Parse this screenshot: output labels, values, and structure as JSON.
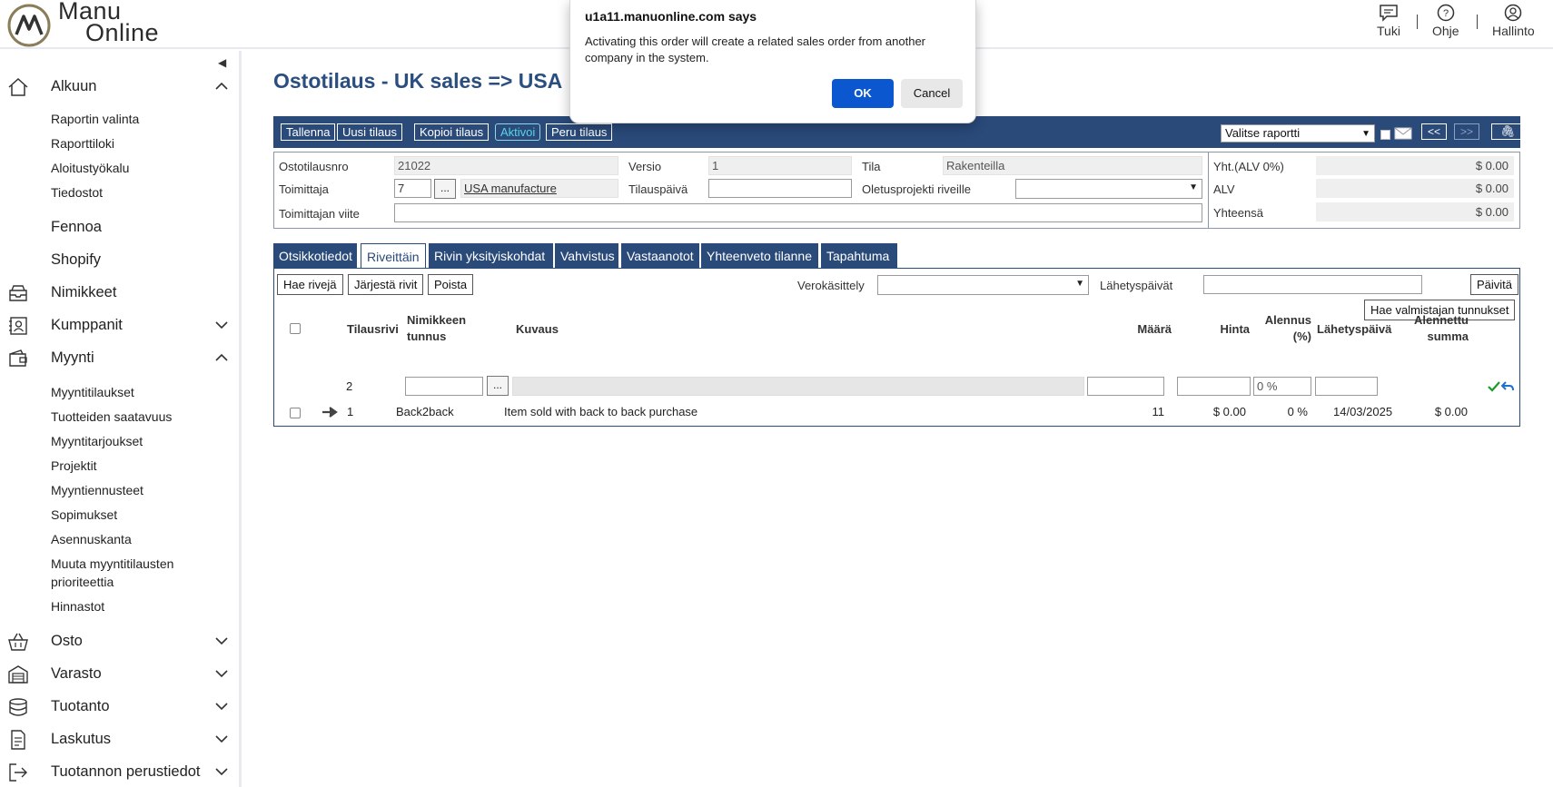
{
  "header": {
    "logo_line1": "Manu",
    "logo_line2": "Online",
    "links": [
      {
        "label": "Tuki",
        "icon": "chat-icon"
      },
      {
        "label": "Ohje",
        "icon": "help-circle-icon"
      },
      {
        "label": "Hallinto",
        "icon": "user-icon"
      }
    ],
    "separator": "|"
  },
  "sidebar": {
    "collapse_glyph": "◀",
    "sections": [
      {
        "label": "Alkuun",
        "icon": "home-icon",
        "expanded": true,
        "items": [
          "Raportin valinta",
          "Raporttiloki",
          "Aloitustyökalu",
          "Tiedostot"
        ]
      },
      {
        "label": "Fennoa"
      },
      {
        "label": "Shopify"
      },
      {
        "label": "Nimikkeet",
        "icon": "inbox-icon"
      },
      {
        "label": "Kumppanit",
        "icon": "contacts-icon",
        "expanded": false
      },
      {
        "label": "Myynti",
        "icon": "wallet-icon",
        "expanded": true,
        "items": [
          "Myyntitilaukset",
          "Tuotteiden saatavuus",
          "Myyntitarjoukset",
          "Projektit",
          "Myyntiennusteet",
          "Sopimukset",
          "Asennuskanta",
          "Muuta myyntitilausten prioriteettia",
          "Hinnastot"
        ]
      },
      {
        "label": "Osto",
        "icon": "basket-icon",
        "expanded": false
      },
      {
        "label": "Varasto",
        "icon": "warehouse-icon",
        "expanded": false
      },
      {
        "label": "Tuotanto",
        "icon": "database-icon",
        "expanded": false
      },
      {
        "label": "Laskutus",
        "icon": "invoice-icon",
        "expanded": false
      },
      {
        "label": "Tuotannon perustiedot",
        "icon": "logout-icon",
        "expanded": false
      }
    ]
  },
  "main": {
    "title": "Ostotilaus - UK sales => USA",
    "toolbar": {
      "buttons": [
        "Tallenna",
        "Uusi tilaus",
        "Kopioi tilaus",
        "Aktivoi",
        "Peru tilaus"
      ],
      "report_select": "Valitse raportti",
      "prev": "<<",
      "next": ">>",
      "attach_glyph": "🖇"
    },
    "form": {
      "order_no_label": "Ostotilausnro",
      "order_no": "21022",
      "version_label": "Versio",
      "version": "1",
      "status_label": "Tila",
      "status": "Rakenteilla",
      "supplier_label": "Toimittaja",
      "supplier_id": "7",
      "lookup_glyph": "...",
      "supplier_name": "USA manufacture",
      "order_date_label": "Tilauspäivä",
      "order_date": "",
      "default_project_label": "Oletusprojekti riveille",
      "default_project": "",
      "supplier_ref_label": "Toimittajan viite",
      "supplier_ref": "",
      "total_ex_vat_label": "Yht.(ALV 0%)",
      "total_ex_vat": "$ 0.00",
      "vat_label": "ALV",
      "vat": "$ 0.00",
      "total_label": "Yhteensä",
      "total": "$ 0.00"
    },
    "tabs": [
      "Otsikkotiedot",
      "Riveittäin",
      "Rivin yksityiskohdat",
      "Vahvistus",
      "Vastaanotot",
      "Yhteenveto tilanne",
      "Tapahtuma"
    ],
    "active_tab": "Riveittäin",
    "rows_panel": {
      "buttons": [
        "Hae rivejä",
        "Järjestä rivit",
        "Poista"
      ],
      "tax_label": "Verokäsittely",
      "dispatch_label": "Lähetyspäivät",
      "update_button": "Päivitä",
      "fetch_codes_button": "Hae valmistajan tunnukset",
      "columns": [
        "Tilausrivi",
        "Nimikkeen tunnus",
        "Kuvaus",
        "Määrä",
        "Hinta",
        "Alennus (%)",
        "Lähetyspäivä",
        "Alennettu summa"
      ],
      "new_row": {
        "row_no": "2",
        "discount": "0 %"
      },
      "rows": [
        {
          "row_no": "1",
          "item_code": "Back2back",
          "description": "Item sold with back to back purchase",
          "qty": "11",
          "price": "$ 0.00",
          "discount": "0 %",
          "dispatch_date": "14/03/2025",
          "discounted_sum": "$ 0.00"
        }
      ]
    }
  },
  "dialog": {
    "title": "u1a11.manuonline.com says",
    "message": "Activating this order will create a related sales order from another company in the system.",
    "ok_label": "OK",
    "cancel_label": "Cancel"
  },
  "colors": {
    "navy": "#2a4a7a",
    "title_blue": "#2a4e7f",
    "active_cyan": "#58d4e8",
    "ok_blue": "#0b57d0",
    "confirm_green": "#1a9b2c",
    "undo_blue": "#1f6fd0"
  }
}
